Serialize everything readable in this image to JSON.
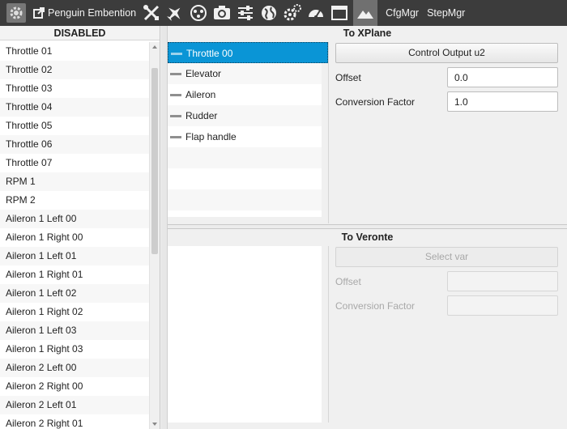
{
  "toolbar": {
    "app_name": "Penguin Embention",
    "tabs": [
      "CfgMgr",
      "StepMgr"
    ]
  },
  "left_panel": {
    "header": "DISABLED",
    "items": [
      "Throttle 01",
      "Throttle 02",
      "Throttle 03",
      "Throttle 04",
      "Throttle 05",
      "Throttle 06",
      "Throttle 07",
      "RPM 1",
      "RPM 2",
      "Aileron 1 Left  00",
      "Aileron 1 Right 00",
      "Aileron 1 Left  01",
      "Aileron 1 Right 01",
      "Aileron 1 Left  02",
      "Aileron 1 Right 02",
      "Aileron 1 Left  03",
      "Aileron 1 Right 03",
      "Aileron 2 Left  00",
      "Aileron 2 Right 00",
      "Aileron 2 Left  01",
      "Aileron 2 Right 01"
    ]
  },
  "to_xplane": {
    "header": "To XPlane",
    "outputs": [
      "Throttle 00",
      "Elevator",
      "Aileron",
      "Rudder",
      "Flap handle"
    ],
    "selected": "Throttle 00",
    "control_button": "Control Output u2",
    "offset_label": "Offset",
    "offset_value": "0.0",
    "conversion_label": "Conversion Factor",
    "conversion_value": "1.0"
  },
  "to_veronte": {
    "header": "To Veronte",
    "select_button": "Select var",
    "offset_label": "Offset",
    "conversion_label": "Conversion Factor"
  },
  "colors": {
    "toolbar_bg": "#3c3c3c",
    "selection": "#0a95d6"
  }
}
